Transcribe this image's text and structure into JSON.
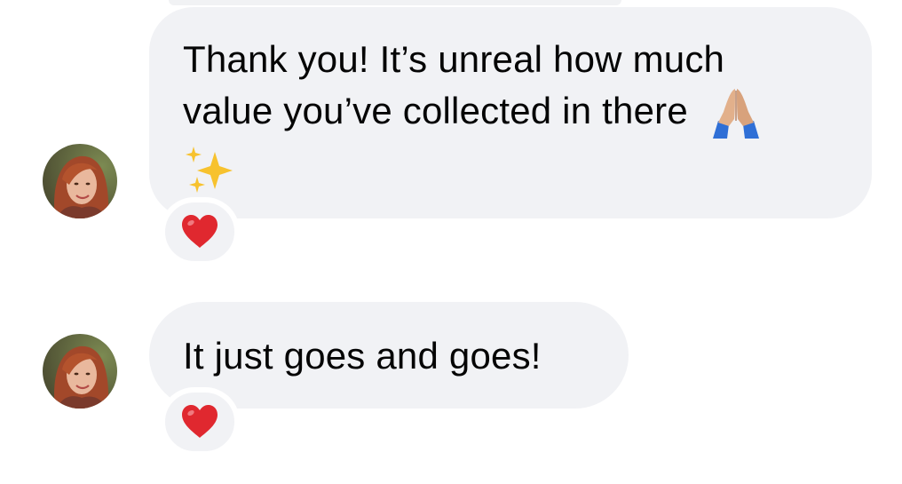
{
  "conversation": {
    "messages": [
      {
        "lines": [
          "Thank you! It’s unreal how much",
          "value you’ve collected in there"
        ],
        "emojis": [
          "folded-hands-emoji",
          "sparkles-emoji"
        ],
        "reaction": "red-heart-emoji"
      },
      {
        "lines": [
          "It just goes and goes!"
        ],
        "reaction": "red-heart-emoji"
      }
    ]
  },
  "colors": {
    "bubble_background": "#f1f2f5",
    "text": "#050505",
    "heart": "#e0282f"
  }
}
